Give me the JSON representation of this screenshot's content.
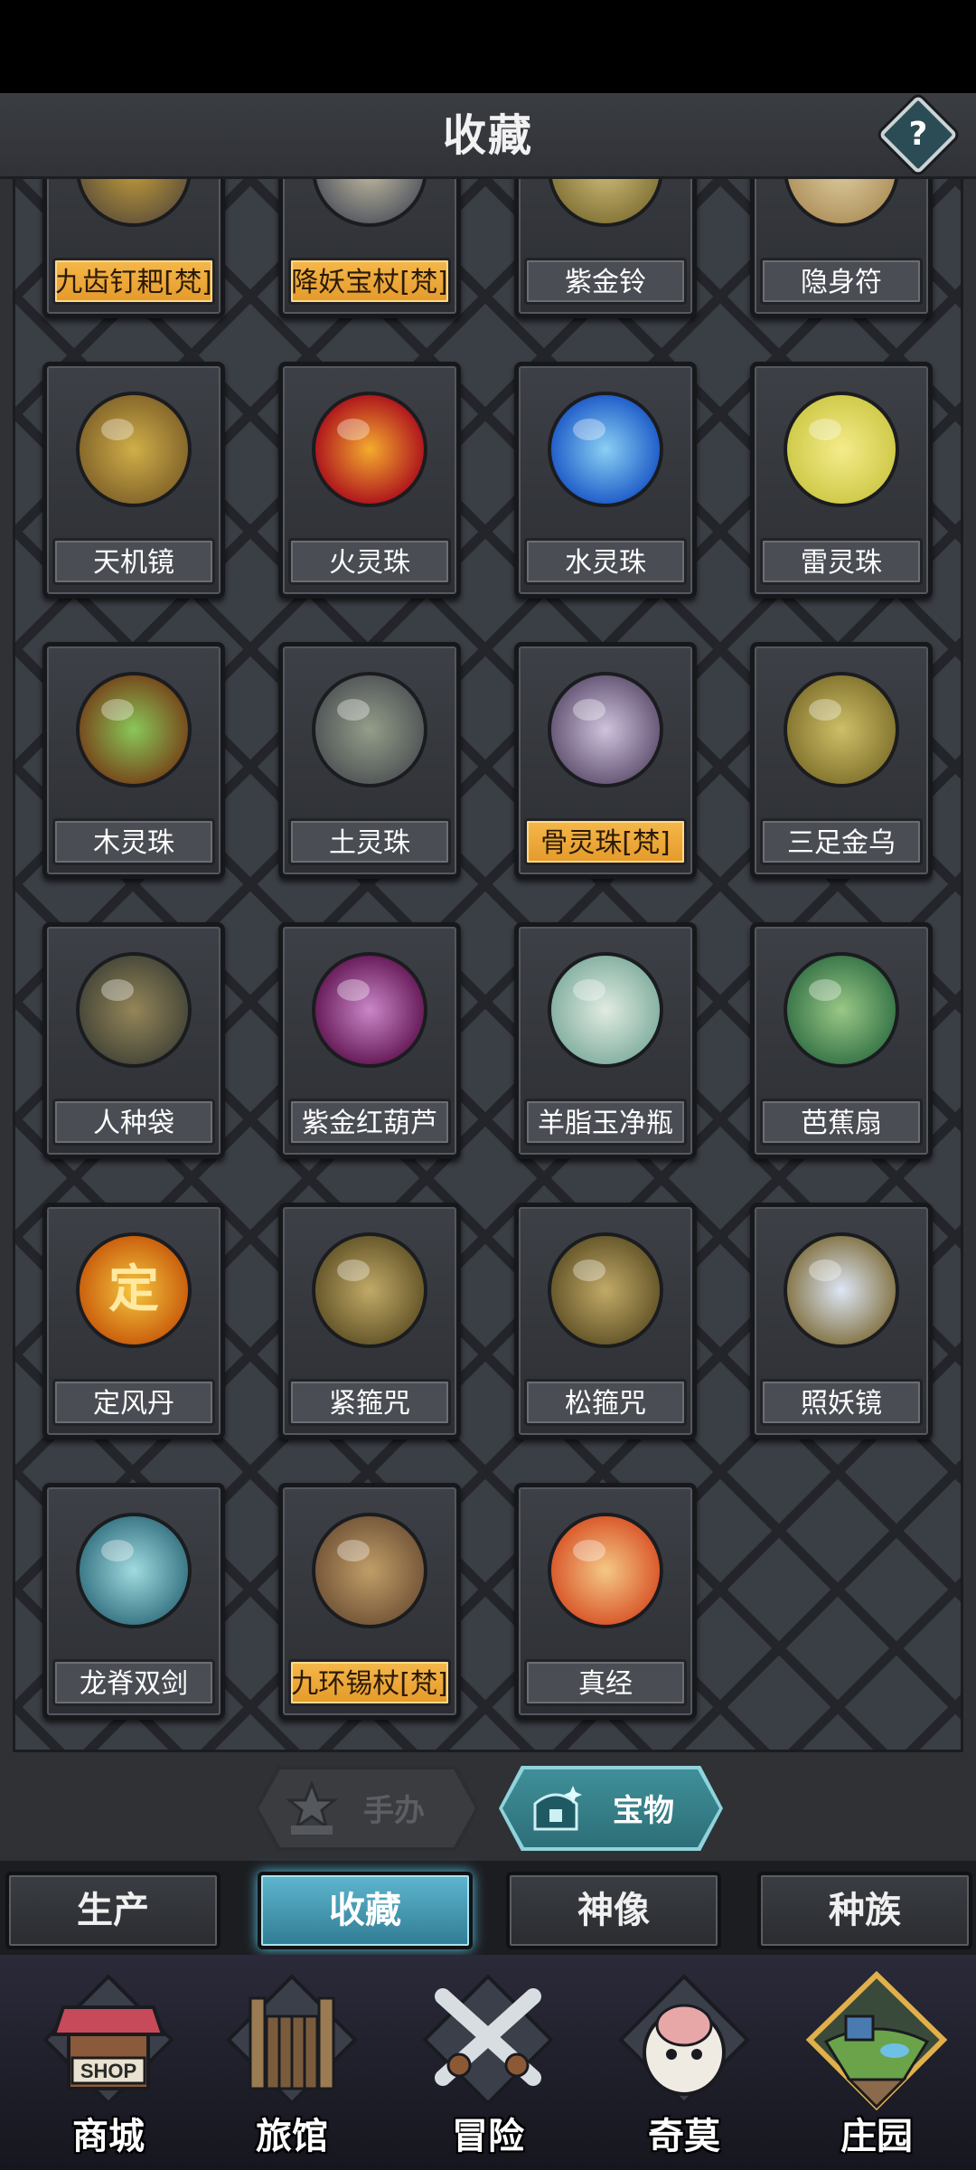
{
  "header": {
    "title": "收藏",
    "help_label": "?"
  },
  "items": [
    {
      "label": "九齿钉耙[梵]",
      "gold": true,
      "icon": "rake-icon"
    },
    {
      "label": "降妖宝杖[梵]",
      "gold": true,
      "icon": "staff-icon"
    },
    {
      "label": "紫金铃",
      "gold": false,
      "icon": "bells-icon"
    },
    {
      "label": "隐身符",
      "gold": false,
      "icon": "talisman-icon"
    },
    {
      "label": "天机镜",
      "gold": false,
      "icon": "mirror-bagua-icon"
    },
    {
      "label": "火灵珠",
      "gold": false,
      "icon": "fire-orb-icon"
    },
    {
      "label": "水灵珠",
      "gold": false,
      "icon": "water-orb-icon"
    },
    {
      "label": "雷灵珠",
      "gold": false,
      "icon": "thunder-orb-icon"
    },
    {
      "label": "木灵珠",
      "gold": false,
      "icon": "wood-orb-icon"
    },
    {
      "label": "土灵珠",
      "gold": false,
      "icon": "earth-orb-icon"
    },
    {
      "label": "骨灵珠[梵]",
      "gold": true,
      "icon": "bone-orb-icon"
    },
    {
      "label": "三足金乌",
      "gold": false,
      "icon": "golden-crow-icon"
    },
    {
      "label": "人种袋",
      "gold": false,
      "icon": "sack-icon"
    },
    {
      "label": "紫金红葫芦",
      "gold": false,
      "icon": "gourd-icon"
    },
    {
      "label": "羊脂玉净瓶",
      "gold": false,
      "icon": "vase-icon"
    },
    {
      "label": "芭蕉扇",
      "gold": false,
      "icon": "fan-icon"
    },
    {
      "label": "定风丹",
      "gold": false,
      "icon": "wind-pill-icon",
      "glyph": "定"
    },
    {
      "label": "紧箍咒",
      "gold": false,
      "icon": "headband-icon"
    },
    {
      "label": "松箍咒",
      "gold": false,
      "icon": "loose-band-icon"
    },
    {
      "label": "照妖镜",
      "gold": false,
      "icon": "demon-mirror-icon"
    },
    {
      "label": "龙脊双剑",
      "gold": false,
      "icon": "twin-swords-icon"
    },
    {
      "label": "九环锡杖[梵]",
      "gold": true,
      "icon": "monk-staff-icon"
    },
    {
      "label": "真经",
      "gold": false,
      "icon": "lotus-scripture-icon"
    }
  ],
  "toggles": {
    "figure": "手办",
    "treasure": "宝物"
  },
  "subtabs": [
    "生产",
    "收藏",
    "神像",
    "种族"
  ],
  "nav": [
    "商城",
    "旅馆",
    "冒险",
    "奇莫",
    "庄园"
  ],
  "shop_sign": "SHOP"
}
